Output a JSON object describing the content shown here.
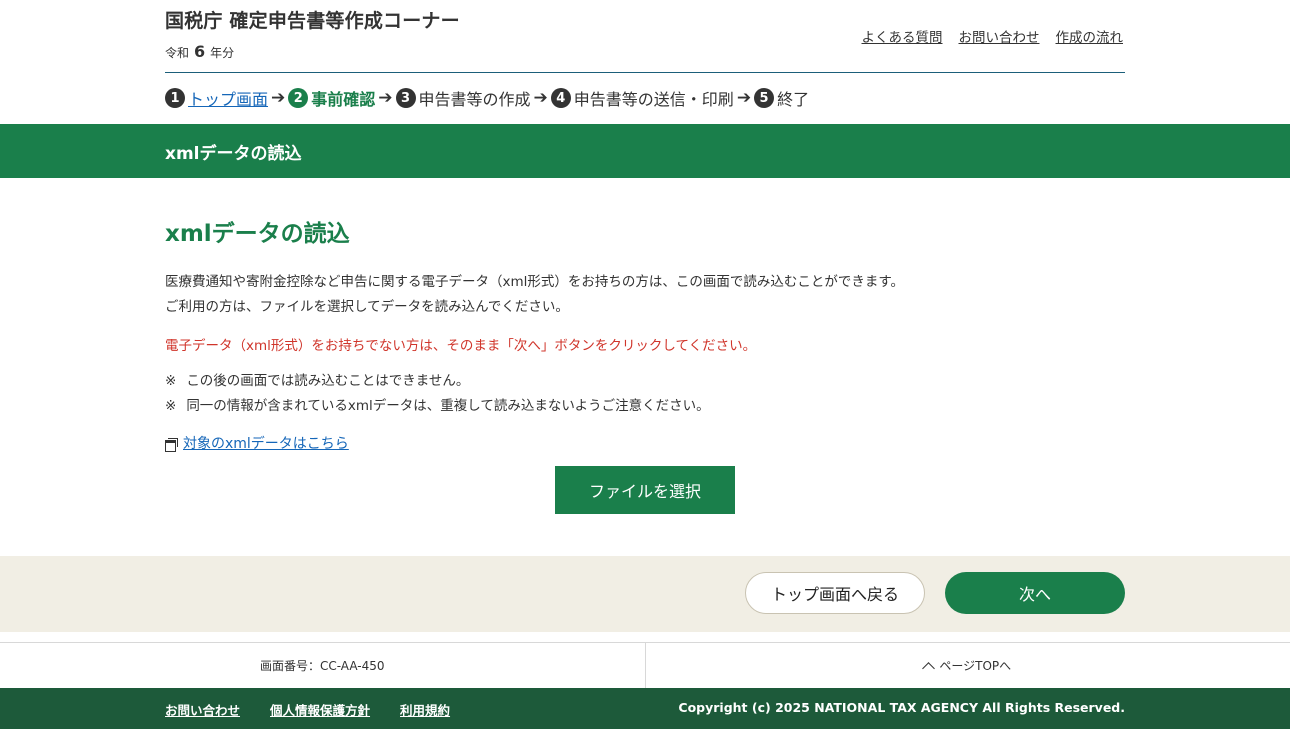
{
  "header": {
    "title": "国税庁 確定申告書等作成コーナー",
    "year_prefix": "令和",
    "year_num": "6",
    "year_suffix": "年分",
    "links": [
      "よくある質問",
      "お問い合わせ",
      "作成の流れ"
    ]
  },
  "steps": [
    {
      "num": "1",
      "label": "トップ画面"
    },
    {
      "num": "2",
      "label": "事前確認"
    },
    {
      "num": "3",
      "label": "申告書等の作成"
    },
    {
      "num": "4",
      "label": "申告書等の送信・印刷"
    },
    {
      "num": "5",
      "label": "終了"
    }
  ],
  "page_bar_title": "xmlデータの読込",
  "main": {
    "heading": "xmlデータの読込",
    "para1_line1": "医療費通知や寄附金控除など申告に関する電子データ（xml形式）をお持ちの方は、この画面で読み込むことができます。",
    "para1_line2": "ご利用の方は、ファイルを選択してデータを読み込んでください。",
    "warning": "電子データ（xml形式）をお持ちでない方は、そのまま「次へ」ボタンをクリックしてください。",
    "note_mark": "※",
    "note1": "この後の画面では読み込むことはできません。",
    "note2": "同一の情報が含まれているxmlデータは、重複して読み込まないようご注意ください。",
    "target_link": "対象のxmlデータはこちら",
    "file_button": "ファイルを選択"
  },
  "actions": {
    "back": "トップ画面へ戻る",
    "next": "次へ"
  },
  "info": {
    "screen_id": "画面番号：CC-AA-450",
    "page_top": "ページTOPへ"
  },
  "footer": {
    "links": [
      "お問い合わせ",
      "個人情報保護方針",
      "利用規約"
    ],
    "copyright": "Copyright (c) 2025 NATIONAL TAX AGENCY All Rights Reserved."
  },
  "colors": {
    "brand_green": "#1a7f4b",
    "footer_green": "#1d5a3a",
    "warning_red": "#d0352b",
    "link_blue": "#1566b8",
    "action_bg": "#f1eee4"
  }
}
